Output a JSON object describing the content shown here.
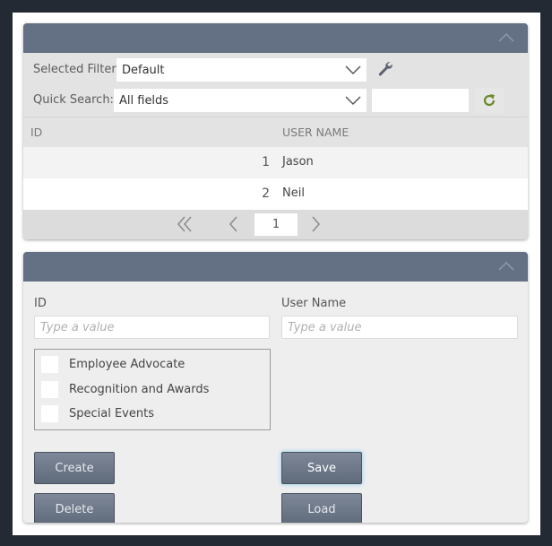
{
  "list_panel": {
    "filter": {
      "label": "Selected Filter:",
      "value": "Default"
    },
    "quick_search": {
      "label": "Quick Search:",
      "scope_value": "All fields",
      "text_value": ""
    },
    "grid": {
      "columns": [
        "ID",
        "USER NAME"
      ],
      "rows": [
        {
          "id": "1",
          "user_name": "Jason"
        },
        {
          "id": "2",
          "user_name": "Neil"
        }
      ]
    },
    "pager": {
      "current_page": "1"
    }
  },
  "form_panel": {
    "id_field": {
      "label": "ID",
      "placeholder": "Type a value",
      "value": ""
    },
    "user_name_field": {
      "label": "User Name",
      "placeholder": "Type a value",
      "value": ""
    },
    "groups": [
      {
        "label": "Employee Advocate",
        "checked": false
      },
      {
        "label": "Recognition and Awards",
        "checked": false
      },
      {
        "label": "Special Events",
        "checked": false
      }
    ],
    "buttons": {
      "create": "Create",
      "save": "Save",
      "delete": "Delete",
      "load": "Load"
    }
  },
  "colors": {
    "header": "#647083",
    "refresh_icon": "#6a8a2a",
    "outer_frame": "#232a33"
  }
}
